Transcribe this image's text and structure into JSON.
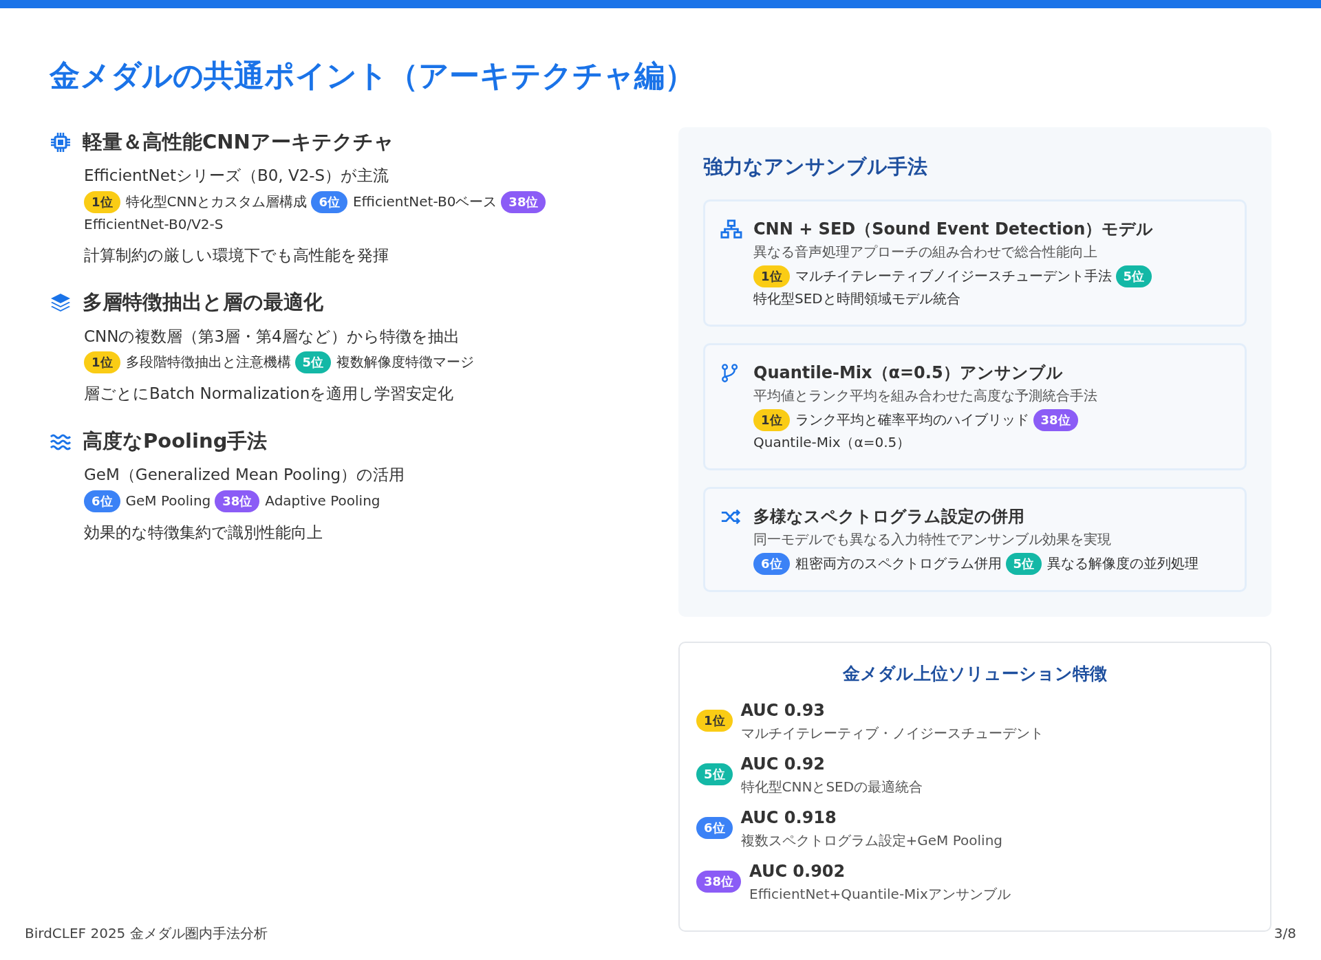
{
  "title": "金メダルの共通ポイント（アーキテクチャ編）",
  "sections": [
    {
      "heading": "軽量＆高性能CNNアーキテクチャ",
      "lead": "EfficientNetシリーズ（B0, V2-S）が主流",
      "tags": [
        {
          "badge": "1位",
          "color": "#facc15",
          "text": "特化型CNNとカスタム層構成"
        },
        {
          "badge": "6位",
          "color": "#3b82f6",
          "text": "EfficientNet-B0ベース"
        },
        {
          "badge": "38位",
          "color": "#8b5cf6",
          "text": "EfficientNet-B0/V2-S"
        }
      ],
      "note": "計算制約の厳しい環境下でも高性能を発揮"
    },
    {
      "heading": "多層特徴抽出と層の最適化",
      "lead": "CNNの複数層（第3層・第4層など）から特徴を抽出",
      "tags": [
        {
          "badge": "1位",
          "color": "#facc15",
          "text": "多段階特徴抽出と注意機構"
        },
        {
          "badge": "5位",
          "color": "#14b8a6",
          "text": "複数解像度特徴マージ"
        }
      ],
      "note": "層ごとにBatch Normalizationを適用し学習安定化"
    },
    {
      "heading": "高度なPooling手法",
      "lead": "GeM（Generalized Mean Pooling）の活用",
      "tags": [
        {
          "badge": "6位",
          "color": "#3b82f6",
          "text": "GeM Pooling"
        },
        {
          "badge": "38位",
          "color": "#8b5cf6",
          "text": "Adaptive Pooling"
        }
      ],
      "note": "効果的な特徴集約で識別性能向上"
    }
  ],
  "ensemble": {
    "title": "強力なアンサンブル手法",
    "cards": [
      {
        "title": "CNN + SED（Sound Event Detection）モデル",
        "desc": "異なる音声処理アプローチの組み合わせで総合性能向上",
        "tags": [
          {
            "badge": "1位",
            "color": "#facc15",
            "text": "マルチイテレーティブノイジースチューデント手法"
          },
          {
            "badge": "5位",
            "color": "#14b8a6",
            "text": "特化型SEDと時間領域モデル統合"
          }
        ]
      },
      {
        "title": "Quantile-Mix（α=0.5）アンサンブル",
        "desc": "平均値とランク平均を組み合わせた高度な予測統合手法",
        "tags": [
          {
            "badge": "1位",
            "color": "#facc15",
            "text": "ランク平均と確率平均のハイブリッド"
          },
          {
            "badge": "38位",
            "color": "#8b5cf6",
            "text": "Quantile-Mix（α=0.5）"
          }
        ]
      },
      {
        "title": "多様なスペクトログラム設定の併用",
        "desc": "同一モデルでも異なる入力特性でアンサンブル効果を実現",
        "tags": [
          {
            "badge": "6位",
            "color": "#3b82f6",
            "text": "粗密両方のスペクトログラム併用"
          },
          {
            "badge": "5位",
            "color": "#14b8a6",
            "text": "異なる解像度の並列処理"
          }
        ]
      }
    ]
  },
  "summary": {
    "title": "金メダル上位ソリューション特徴",
    "items": [
      {
        "badge": "1位",
        "color": "#facc15",
        "score": "AUC 0.93",
        "desc": "マルチイテレーティブ・ノイジースチューデント"
      },
      {
        "badge": "5位",
        "color": "#14b8a6",
        "score": "AUC 0.92",
        "desc": "特化型CNNとSEDの最適統合"
      },
      {
        "badge": "6位",
        "color": "#3b82f6",
        "score": "AUC 0.918",
        "desc": "複数スペクトログラム設定+GeM Pooling"
      },
      {
        "badge": "38位",
        "color": "#8b5cf6",
        "score": "AUC 0.902",
        "desc": "EfficientNet+Quantile-Mixアンサンブル"
      }
    ]
  },
  "footer": {
    "left": "BirdCLEF 2025 金メダル圏内手法分析",
    "right": "3/8"
  }
}
